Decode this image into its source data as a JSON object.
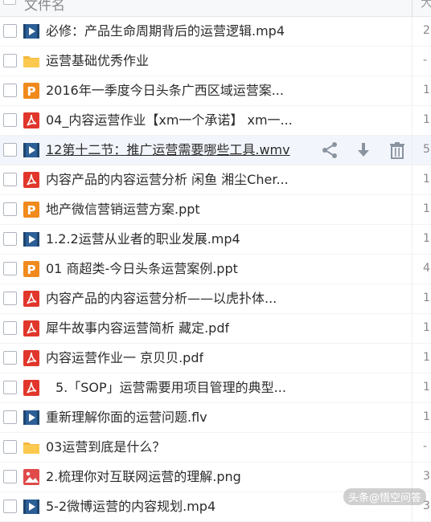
{
  "header": {
    "title": "文件名",
    "size_col": "大"
  },
  "files": [
    {
      "name": "必修：产品生命周期背后的运营逻辑.mp4",
      "type": "video",
      "col2": "2"
    },
    {
      "name": "运营基础优秀作业",
      "type": "folder",
      "col2": "-"
    },
    {
      "name": "2016年一季度今日头条广西区域运营案...",
      "type": "ppt",
      "col2": "1"
    },
    {
      "name": "04_内容运营作业【xm一个承诺】 xm一...",
      "type": "pdf",
      "col2": "1"
    },
    {
      "name": "12第十二节：推广运营需要哪些工具.wmv",
      "type": "video",
      "col2": "5",
      "hover": true
    },
    {
      "name": "内容产品的内容运营分析 闲鱼 湘尘Cher...",
      "type": "pdf",
      "col2": "1"
    },
    {
      "name": "地产微信营销运营方案.ppt",
      "type": "ppt",
      "col2": "1"
    },
    {
      "name": "1.2.2运营从业者的职业发展.mp4",
      "type": "video",
      "col2": "1"
    },
    {
      "name": "01 商超类-今日头条运营案例.ppt",
      "type": "ppt",
      "col2": "4"
    },
    {
      "name": "内容产品的内容运营分析——以虎扑体...",
      "type": "pdf",
      "col2": "1"
    },
    {
      "name": "犀牛故事内容运营简析 藏定.pdf",
      "type": "pdf",
      "col2": "1"
    },
    {
      "name": "内容运营作业一 京贝贝.pdf",
      "type": "pdf",
      "col2": "1"
    },
    {
      "name": "5.「SOP」运营需要用项目管理的典型...",
      "type": "pdf",
      "col2": "1",
      "indent": true
    },
    {
      "name": "重新理解你面的运营问题.flv",
      "type": "video",
      "col2": "1"
    },
    {
      "name": "03运营到底是什么？",
      "type": "folder",
      "col2": "-"
    },
    {
      "name": "2.梳理你对互联网运营的理解.png",
      "type": "image",
      "col2": "3"
    },
    {
      "name": "5-2微博运营的内容规划.mp4",
      "type": "video",
      "col2": "3"
    }
  ],
  "actions": [
    "share-icon",
    "download-icon",
    "delete-icon"
  ],
  "watermark": "头条@悟空问答",
  "colors": {
    "video": "#2c5f96",
    "folder": "#f5b83d",
    "ppt": "#f08a1c",
    "pdf": "#e1362b",
    "image": "#e04a4a"
  }
}
